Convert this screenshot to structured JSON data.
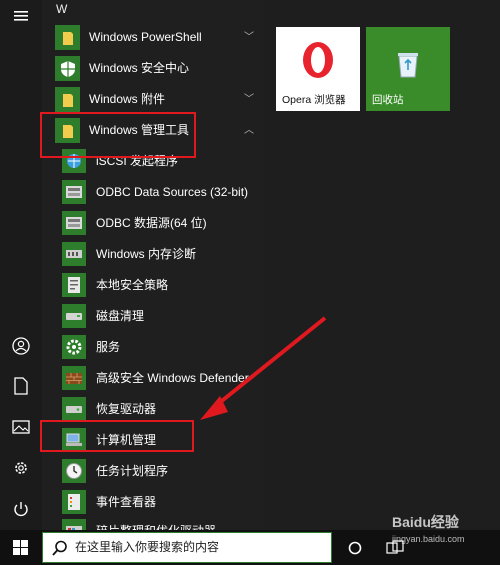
{
  "start_list": {
    "section_letter": "W",
    "items": [
      {
        "label": "Windows PowerShell",
        "icon": "folder-icon",
        "chevron": "﹀"
      },
      {
        "label": "Windows 安全中心",
        "icon": "shield-icon",
        "chevron": ""
      },
      {
        "label": "Windows 附件",
        "icon": "folder-icon",
        "chevron": "﹀"
      },
      {
        "label": "Windows 管理工具",
        "icon": "folder-icon",
        "chevron": "︿"
      }
    ],
    "sub_items": [
      {
        "label": "iSCSI 发起程序",
        "icon": "iscsi-icon"
      },
      {
        "label": "ODBC Data Sources (32-bit)",
        "icon": "odbc-icon"
      },
      {
        "label": "ODBC 数据源(64 位)",
        "icon": "odbc-icon"
      },
      {
        "label": "Windows 内存诊断",
        "icon": "memory-diagnostic-icon"
      },
      {
        "label": "本地安全策略",
        "icon": "security-policy-icon"
      },
      {
        "label": "磁盘清理",
        "icon": "disk-cleanup-icon"
      },
      {
        "label": "服务",
        "icon": "services-gear-icon"
      },
      {
        "label": "高级安全 Windows Defender",
        "icon": "firewall-icon"
      },
      {
        "label": "恢复驱动器",
        "icon": "recovery-drive-icon"
      },
      {
        "label": "计算机管理",
        "icon": "computer-management-icon"
      },
      {
        "label": "任务计划程序",
        "icon": "task-scheduler-icon"
      },
      {
        "label": "事件查看器",
        "icon": "event-viewer-icon"
      },
      {
        "label": "碎片整理和优化驱动器",
        "icon": "defrag-icon"
      }
    ]
  },
  "tiles": [
    {
      "label": "Opera 浏览器",
      "icon": "opera-icon",
      "bg": "#ffffff",
      "fg": "#111111"
    },
    {
      "label": "回收站",
      "icon": "recycle-bin-icon",
      "bg": "#3a8c2a",
      "fg": "#ffffff"
    }
  ],
  "rail": {
    "icons": [
      "hamburger-menu-icon",
      "user-icon",
      "document-icon",
      "pictures-icon",
      "settings-gear-icon",
      "power-icon"
    ]
  },
  "taskbar": {
    "search_placeholder": "在这里输入你要搜索的内容",
    "start_icon": "windows-logo-icon",
    "task_view_icon": "task-view-icon"
  },
  "watermark": {
    "brand": "Baidu经验",
    "url": "jingyan.baidu.com"
  },
  "colors": {
    "accent_green": "#2d7d2d",
    "highlight_red": "#e0191f"
  }
}
